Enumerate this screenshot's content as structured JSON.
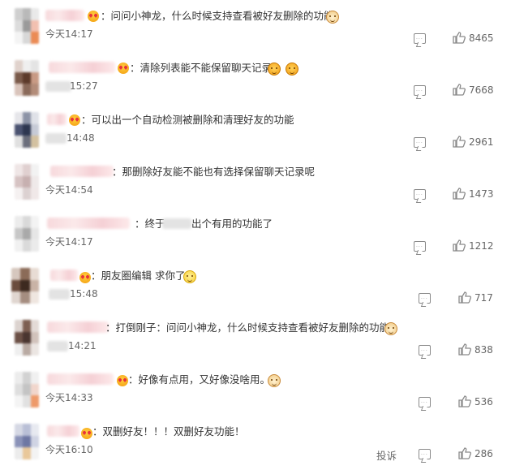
{
  "comments": [
    {
      "comment": "：问问小神龙，什么时候支持查看被好友删除的功能",
      "time": "今天14:17",
      "likes": "8465"
    },
    {
      "comment": "：清除列表能不能保留聊天记录",
      "time": "15:27",
      "likes": "7668"
    },
    {
      "comment": "：可以出一个自动检测被删除和清理好友的功能",
      "time": "14:48",
      "likes": "2961"
    },
    {
      "comment": "：那删除好友能不能也有选择保留聊天记录呢",
      "time": "今天14:54",
      "likes": "1473"
    },
    {
      "comment": "：终于",
      "comment_rest": "出个有用的功能了",
      "time": "今天14:17",
      "likes": "1212"
    },
    {
      "comment": "：朋友圈编辑 求你了",
      "time": "15:48",
      "likes": "717"
    },
    {
      "comment": "：打倒刚子：问问小神龙，什么时候支持查看被好友删除的功能",
      "time": "14:21",
      "likes": "838"
    },
    {
      "comment": "：好像有点用，又好像没啥用。",
      "time": "今天14:33",
      "likes": "536"
    },
    {
      "comment": "：双删好友！！！双删好友功能！",
      "time": "今天16:10",
      "likes": "286",
      "report": "投诉"
    }
  ],
  "icons": {
    "reply": "comment-icon",
    "like": "thumbs-up-icon"
  }
}
